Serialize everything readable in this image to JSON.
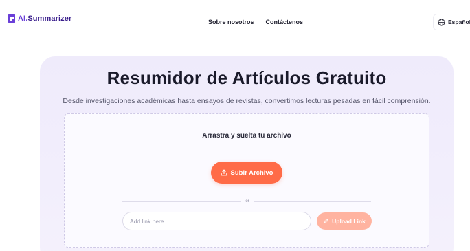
{
  "header": {
    "logo": {
      "prefix": "AI.",
      "name": "Summarizer"
    },
    "nav": [
      {
        "label": "Sobre nosotros"
      },
      {
        "label": "Contáctenos"
      }
    ],
    "language": {
      "label": "Español",
      "icon": "globe-icon"
    }
  },
  "hero": {
    "title": "Resumidor de Artículos Gratuito",
    "subtitle": "Desde investigaciones académicas hasta ensayos de revistas, convertimos lecturas pesadas en fácil comprensión."
  },
  "uploader": {
    "drop_label": "Arrastra y suelta tu archivo",
    "upload_button": {
      "label": "Subir Archivo",
      "icon": "upload-icon"
    },
    "divider_label": "or",
    "link_input": {
      "placeholder": "Add link here",
      "value": ""
    },
    "link_button": {
      "label": "Upload Link",
      "icon": "link-icon"
    }
  },
  "colors": {
    "brand": "#6a3fd8",
    "accent": "#ff6b47",
    "accent_disabled": "#ffb3a0",
    "hero_bg": "#efebfb"
  }
}
